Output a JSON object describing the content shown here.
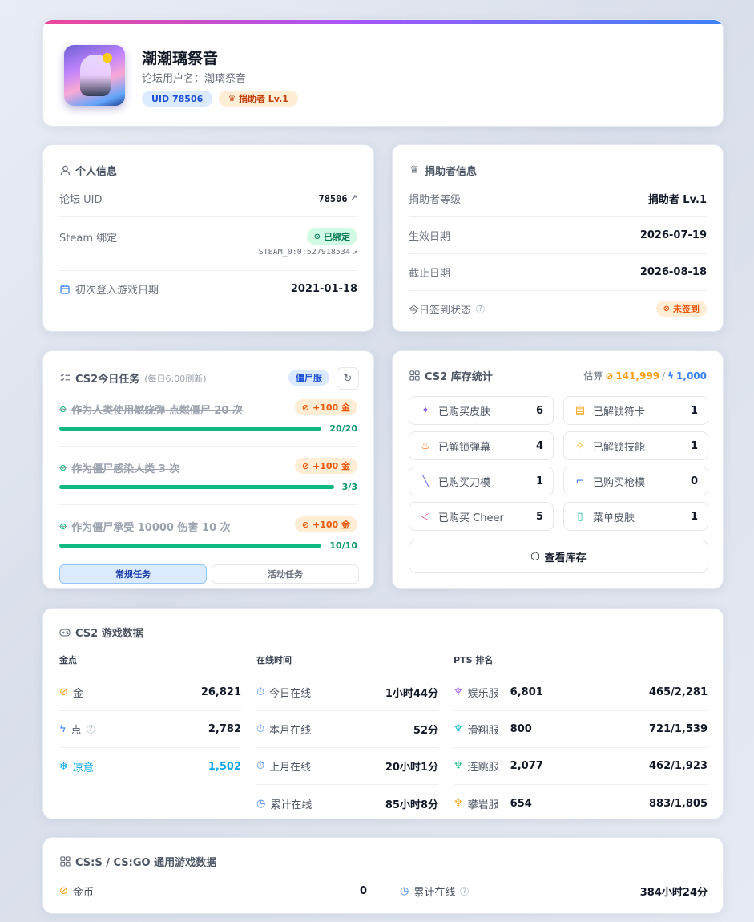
{
  "profile": {
    "name": "潮潮璃祭音",
    "forum_username": "论坛用户名：潮璃祭音",
    "uid_badge": "UID 78506",
    "donor_badge": "捐助者 Lv.1"
  },
  "personal": {
    "title": "个人信息",
    "uid_label": "论坛 UID",
    "uid_value": "78506",
    "steam_label": "Steam 绑定",
    "steam_status": "已绑定",
    "steam_id": "STEAM_0:0:527918534",
    "first_login_label": "初次登入游戏日期",
    "first_login_value": "2021-01-18"
  },
  "donor": {
    "title": "捐助者信息",
    "level_label": "捐助者等级",
    "level_value": "捐助者 Lv.1",
    "start_label": "生效日期",
    "start_value": "2026-07-19",
    "end_label": "截止日期",
    "end_value": "2026-08-18",
    "checkin_label": "今日签到状态",
    "checkin_status": "未签到"
  },
  "tasks": {
    "title": "CS2今日任务",
    "subtitle": "(每日6:00刷新)",
    "server_badge": "僵尸服",
    "items": [
      {
        "name": "作为人类使用燃烧弹 点燃僵尸 20 次",
        "reward": "+100 金",
        "progress": "20/20",
        "fraction": 1.0
      },
      {
        "name": "作为僵尸感染人类 3 次",
        "reward": "+100 金",
        "progress": "3/3",
        "fraction": 1.0
      },
      {
        "name": "作为僵尸承受 10000 伤害 10 次",
        "reward": "+100 金",
        "progress": "10/10",
        "fraction": 1.0
      }
    ],
    "tab_regular": "常规任务",
    "tab_event": "活动任务"
  },
  "inventory": {
    "title": "CS2 库存统计",
    "estimate_label": "估算",
    "estimate_gold": "141,999",
    "estimate_sep": "/",
    "estimate_points": "1,000",
    "stats": [
      {
        "label": "已购买皮肤",
        "value": "6",
        "icon": "person-icon",
        "color": "#8b5cf6"
      },
      {
        "label": "已解锁符卡",
        "value": "1",
        "icon": "card-icon",
        "color": "#f59e0b"
      },
      {
        "label": "已解锁弹幕",
        "value": "4",
        "icon": "flame-icon",
        "color": "#f97316"
      },
      {
        "label": "已解锁技能",
        "value": "1",
        "icon": "sparkle-icon",
        "color": "#eab308"
      },
      {
        "label": "已购买刀模",
        "value": "1",
        "icon": "knife-icon",
        "color": "#6366f1"
      },
      {
        "label": "已购买枪模",
        "value": "0",
        "icon": "gun-icon",
        "color": "#3b82f6"
      },
      {
        "label": "已购买 Cheer",
        "value": "5",
        "icon": "megaphone-icon",
        "color": "#ec4899"
      },
      {
        "label": "菜单皮肤",
        "value": "1",
        "icon": "book-icon",
        "color": "#14b8a6"
      }
    ],
    "view_button": "查看库存"
  },
  "game": {
    "title": "CS2 游戏数据",
    "gold_header": "金点",
    "gold_rows": [
      {
        "label": "金",
        "value": "26,821"
      },
      {
        "label": "点",
        "value": "2,782"
      },
      {
        "label": "凉意",
        "value": "1,502"
      }
    ],
    "time_header": "在线时间",
    "time_rows": [
      {
        "label": "今日在线",
        "value": "1小时44分"
      },
      {
        "label": "本月在线",
        "value": "52分"
      },
      {
        "label": "上月在线",
        "value": "20小时1分"
      },
      {
        "label": "累计在线",
        "value": "85小时8分"
      }
    ],
    "pts_header": "PTS 排名",
    "pts_rows": [
      {
        "label": "娱乐服",
        "pts": "6,801",
        "rank": "465/2,281",
        "color": "#a855f7"
      },
      {
        "label": "滑翔服",
        "pts": "800",
        "rank": "721/1,539",
        "color": "#06b6d4"
      },
      {
        "label": "连跳服",
        "pts": "2,077",
        "rank": "462/1,923",
        "color": "#10b981"
      },
      {
        "label": "攀岩服",
        "pts": "654",
        "rank": "883/1,805",
        "color": "#f59e0b"
      }
    ]
  },
  "legacy": {
    "title": "CS:S / CS:GO 通用游戏数据",
    "coins_label": "金币",
    "coins_value": "0",
    "total_label": "累计在线",
    "total_value": "384小时24分"
  }
}
